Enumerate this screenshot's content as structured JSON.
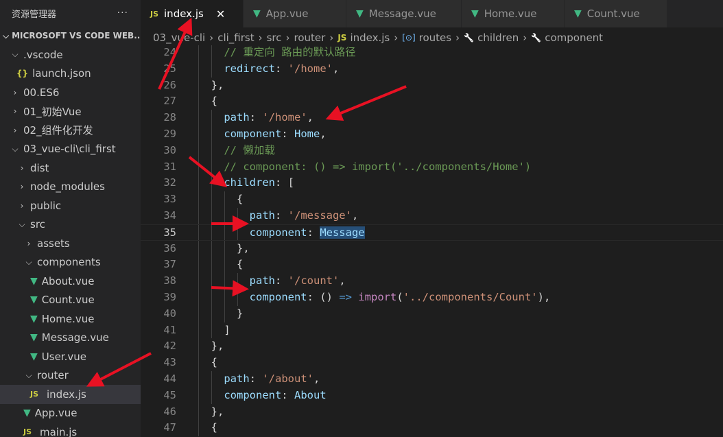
{
  "sidebar": {
    "title": "资源管理器",
    "more": "···",
    "workspace": "MICROSOFT VS CODE WEB...",
    "items": [
      {
        "label": ".vscode",
        "depth": 0,
        "type": "folder-open"
      },
      {
        "label": "launch.json",
        "depth": 1,
        "type": "json"
      },
      {
        "label": "00.ES6",
        "depth": 0,
        "type": "folder"
      },
      {
        "label": "01_初始Vue",
        "depth": 0,
        "type": "folder"
      },
      {
        "label": "02_组件化开发",
        "depth": 0,
        "type": "folder"
      },
      {
        "label": "03_vue-cli\\cli_first",
        "depth": 0,
        "type": "folder-open"
      },
      {
        "label": "dist",
        "depth": 1,
        "type": "folder"
      },
      {
        "label": "node_modules",
        "depth": 1,
        "type": "folder"
      },
      {
        "label": "public",
        "depth": 1,
        "type": "folder"
      },
      {
        "label": "src",
        "depth": 1,
        "type": "folder-open"
      },
      {
        "label": "assets",
        "depth": 2,
        "type": "folder"
      },
      {
        "label": "components",
        "depth": 2,
        "type": "folder-open"
      },
      {
        "label": "About.vue",
        "depth": 3,
        "type": "vue"
      },
      {
        "label": "Count.vue",
        "depth": 3,
        "type": "vue"
      },
      {
        "label": "Home.vue",
        "depth": 3,
        "type": "vue"
      },
      {
        "label": "Message.vue",
        "depth": 3,
        "type": "vue"
      },
      {
        "label": "User.vue",
        "depth": 3,
        "type": "vue"
      },
      {
        "label": "router",
        "depth": 2,
        "type": "folder-open"
      },
      {
        "label": "index.js",
        "depth": 3,
        "type": "js",
        "selected": true
      },
      {
        "label": "App.vue",
        "depth": 2,
        "type": "vue"
      },
      {
        "label": "main.js",
        "depth": 2,
        "type": "js"
      }
    ]
  },
  "tabs": [
    {
      "label": "index.js",
      "icon": "JS",
      "active": true,
      "close": "✕"
    },
    {
      "label": "App.vue",
      "icon": "V"
    },
    {
      "label": "Message.vue",
      "icon": "V"
    },
    {
      "label": "Home.vue",
      "icon": "V"
    },
    {
      "label": "Count.vue",
      "icon": "V"
    }
  ],
  "breadcrumb": [
    "03_vue-cli",
    "cli_first",
    "src",
    "router",
    "index.js",
    "routes",
    "children",
    "component"
  ],
  "editor": {
    "active_line": "35",
    "lines": [
      {
        "n": "24",
        "code": [
          [
            "c",
            "    // 重定向 路由的默认路径"
          ]
        ]
      },
      {
        "n": "25",
        "code": [
          [
            "k",
            "    redirect"
          ],
          [
            "p",
            ": "
          ],
          [
            "s",
            "'/home'"
          ],
          [
            "p",
            ","
          ]
        ]
      },
      {
        "n": "26",
        "code": [
          [
            "p",
            "  },"
          ]
        ]
      },
      {
        "n": "27",
        "code": [
          [
            "p",
            "  {"
          ]
        ]
      },
      {
        "n": "28",
        "code": [
          [
            "k",
            "    path"
          ],
          [
            "p",
            ": "
          ],
          [
            "s",
            "'/home'"
          ],
          [
            "p",
            ","
          ]
        ]
      },
      {
        "n": "29",
        "code": [
          [
            "k",
            "    component"
          ],
          [
            "p",
            ": "
          ],
          [
            "v",
            "Home"
          ],
          [
            "p",
            ","
          ]
        ]
      },
      {
        "n": "30",
        "code": [
          [
            "c",
            "    // 懒加载"
          ]
        ]
      },
      {
        "n": "31",
        "code": [
          [
            "c",
            "    // component: () => import('../components/Home')"
          ]
        ]
      },
      {
        "n": "32",
        "code": [
          [
            "k",
            "    children"
          ],
          [
            "p",
            ": ["
          ]
        ]
      },
      {
        "n": "33",
        "code": [
          [
            "p",
            "      {"
          ]
        ]
      },
      {
        "n": "34",
        "code": [
          [
            "k",
            "        path"
          ],
          [
            "p",
            ": "
          ],
          [
            "s",
            "'/message'"
          ],
          [
            "p",
            ","
          ]
        ]
      },
      {
        "n": "35",
        "code": [
          [
            "k",
            "        component"
          ],
          [
            "p",
            ": "
          ],
          [
            "hl",
            "Message"
          ]
        ]
      },
      {
        "n": "36",
        "code": [
          [
            "p",
            "      },"
          ]
        ]
      },
      {
        "n": "37",
        "code": [
          [
            "p",
            "      {"
          ]
        ]
      },
      {
        "n": "38",
        "code": [
          [
            "k",
            "        path"
          ],
          [
            "p",
            ": "
          ],
          [
            "s",
            "'/count'"
          ],
          [
            "p",
            ","
          ]
        ]
      },
      {
        "n": "39",
        "code": [
          [
            "k",
            "        component"
          ],
          [
            "p",
            ": () "
          ],
          [
            "op",
            "=>"
          ],
          [
            "p",
            " "
          ],
          [
            "kw",
            "import"
          ],
          [
            "p",
            "("
          ],
          [
            "s",
            "'../components/Count'"
          ],
          [
            "p",
            "),"
          ]
        ]
      },
      {
        "n": "40",
        "code": [
          [
            "p",
            "      }"
          ]
        ]
      },
      {
        "n": "41",
        "code": [
          [
            "p",
            "    ]"
          ]
        ]
      },
      {
        "n": "42",
        "code": [
          [
            "p",
            "  },"
          ]
        ]
      },
      {
        "n": "43",
        "code": [
          [
            "p",
            "  {"
          ]
        ]
      },
      {
        "n": "44",
        "code": [
          [
            "k",
            "    path"
          ],
          [
            "p",
            ": "
          ],
          [
            "s",
            "'/about'"
          ],
          [
            "p",
            ","
          ]
        ]
      },
      {
        "n": "45",
        "code": [
          [
            "k",
            "    component"
          ],
          [
            "p",
            ": "
          ],
          [
            "v",
            "About"
          ]
        ]
      },
      {
        "n": "46",
        "code": [
          [
            "p",
            "  },"
          ]
        ]
      },
      {
        "n": "47",
        "code": [
          [
            "p",
            "  {"
          ]
        ]
      }
    ]
  },
  "colors": {
    "accent_vue": "#41b883",
    "accent_js": "#cbcb41",
    "annotation_arrow": "#e81123"
  }
}
